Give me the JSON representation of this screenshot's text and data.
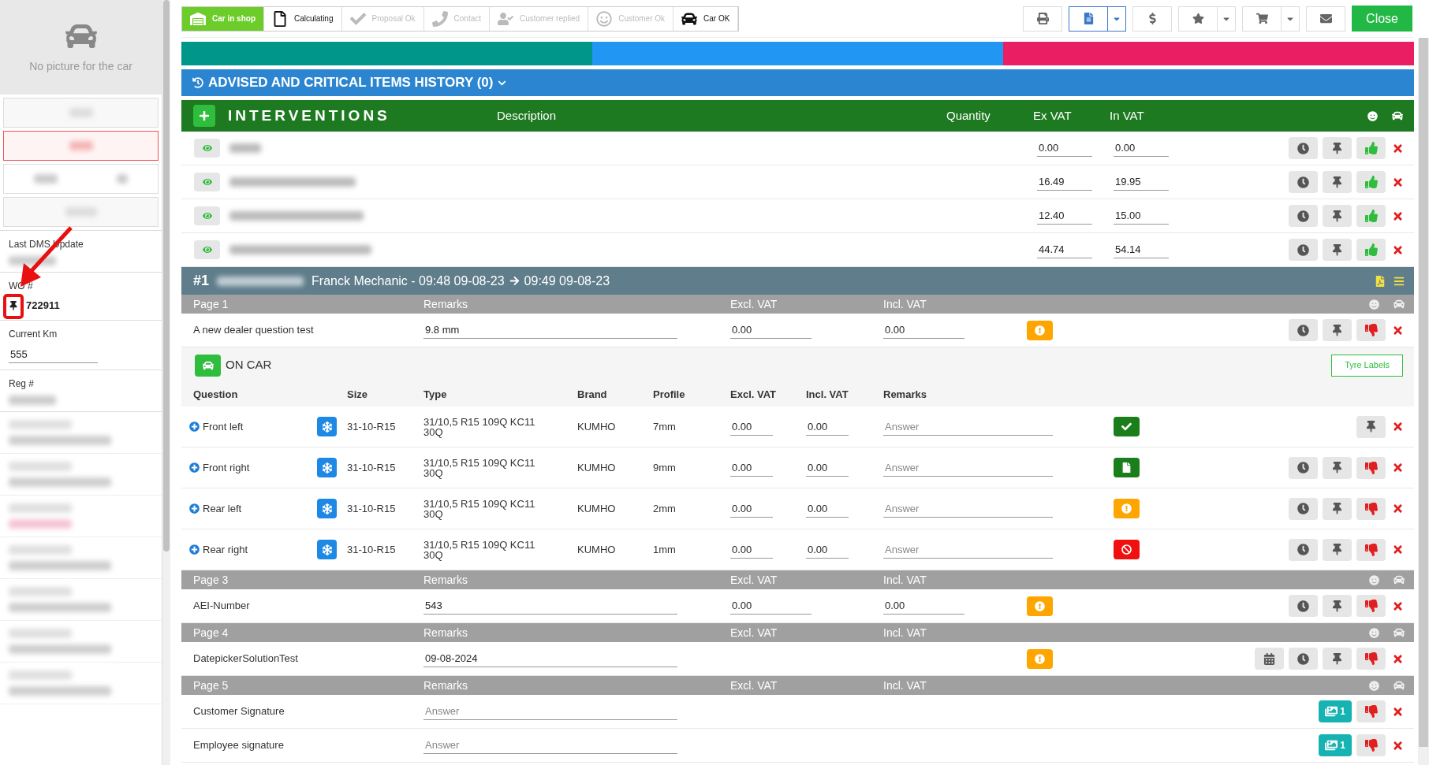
{
  "sidebar": {
    "no_picture": "No picture for the car",
    "fields": [
      {
        "label": "Last DMS Update",
        "kind": "blurred"
      },
      {
        "label": "WO #",
        "kind": "pinned",
        "value": "722911"
      },
      {
        "label": "Current Km",
        "kind": "input",
        "value": "555"
      },
      {
        "label": "Reg #",
        "kind": "blurred"
      }
    ]
  },
  "steps": [
    {
      "label": "Car in shop",
      "selected": true,
      "disabled": false
    },
    {
      "label": "Calculating",
      "selected": false,
      "disabled": false
    },
    {
      "label": "Proposal Ok",
      "selected": false,
      "disabled": true
    },
    {
      "label": "Contact",
      "selected": false,
      "disabled": true
    },
    {
      "label": "Customer replied",
      "selected": false,
      "disabled": true
    },
    {
      "label": "Customer Ok",
      "selected": false,
      "disabled": true
    },
    {
      "label": "Car OK",
      "selected": false,
      "disabled": false
    }
  ],
  "toolbar": [
    {
      "kind": "print"
    },
    {
      "kind": "document",
      "dropdown": true,
      "selected": true
    },
    {
      "kind": "dollar"
    },
    {
      "kind": "star",
      "dropdown": true,
      "selected": false
    },
    {
      "kind": "cart",
      "dropdown": true,
      "selected": false
    },
    {
      "kind": "mail"
    }
  ],
  "close_button": "Close",
  "progress_segments": [
    {
      "color": "#00968a"
    },
    {
      "color": "#2196f3"
    },
    {
      "color": "#e91e63"
    }
  ],
  "history_title": "ADVISED AND CRITICAL ITEMS HISTORY (0)",
  "interventions": {
    "title": "INTERVENTIONS",
    "columns": [
      "Description",
      "Quantity",
      "Ex VAT",
      "In VAT"
    ],
    "rows": [
      {
        "ex_vat": "0.00",
        "in_vat": "0.00",
        "approved": true
      },
      {
        "ex_vat": "16.49",
        "in_vat": "19.95",
        "approved": true
      },
      {
        "ex_vat": "12.40",
        "in_vat": "15.00",
        "approved": true
      },
      {
        "ex_vat": "44.74",
        "in_vat": "54.14",
        "approved": true
      }
    ]
  },
  "job": {
    "number": "#1",
    "mechanic": "Franck Mechanic - 09:48 09-08-23",
    "end": "09:49 09-08-23"
  },
  "pages": [
    {
      "title": "Page 1",
      "columns": [
        "Remarks",
        "Excl. VAT",
        "Incl. VAT"
      ],
      "rows": [
        {
          "question": "A new dealer question test",
          "remark": "9.8 mm",
          "excl": "0.00",
          "incl": "0.00",
          "badge": {
            "kind": "warning"
          },
          "actions": [
            {
              "kind": "clock"
            },
            {
              "kind": "pin"
            }
          ],
          "approved": false
        }
      ],
      "tyres": {
        "title": "ON CAR",
        "labels_button": "Tyre Labels",
        "columns": [
          "Question",
          "Size",
          "Type",
          "Brand",
          "Profile",
          "Excl. VAT",
          "Incl. VAT",
          "Remarks"
        ],
        "rows": [
          {
            "position": "Front left",
            "size": "31-10-R15",
            "type": "31/10,5 R15 109Q KC11 30Q",
            "brand": "KUMHO",
            "profile": "7mm",
            "excl": "0.00",
            "incl": "0.00",
            "placeholder": "Answer",
            "badge": {
              "kind": "ok"
            },
            "actions": [
              {
                "kind": "pin"
              }
            ]
          },
          {
            "position": "Front right",
            "size": "31-10-R15",
            "type": "31/10,5 R15 109Q KC11 30Q",
            "brand": "KUMHO",
            "profile": "9mm",
            "excl": "0.00",
            "incl": "0.00",
            "placeholder": "Answer",
            "badge": {
              "kind": "file"
            },
            "actions": [
              {
                "kind": "clock"
              },
              {
                "kind": "pin"
              }
            ],
            "approved": false
          },
          {
            "position": "Rear left",
            "size": "31-10-R15",
            "type": "31/10,5 R15 109Q KC11 30Q",
            "brand": "KUMHO",
            "profile": "2mm",
            "excl": "0.00",
            "incl": "0.00",
            "placeholder": "Answer",
            "badge": {
              "kind": "warning"
            },
            "actions": [
              {
                "kind": "clock"
              },
              {
                "kind": "pin"
              }
            ],
            "approved": false
          },
          {
            "position": "Rear right",
            "size": "31-10-R15",
            "type": "31/10,5 R15 109Q KC11 30Q",
            "brand": "KUMHO",
            "profile": "1mm",
            "excl": "0.00",
            "incl": "0.00",
            "placeholder": "Answer",
            "badge": {
              "kind": "forbidden"
            },
            "actions": [
              {
                "kind": "clock"
              },
              {
                "kind": "pin"
              }
            ],
            "approved": false
          }
        ]
      }
    },
    {
      "title": "Page 3",
      "columns": [
        "Remarks",
        "Excl. VAT",
        "Incl. VAT"
      ],
      "rows": [
        {
          "question": "AEI-Number",
          "remark": "543",
          "excl": "0.00",
          "incl": "0.00",
          "badge": {
            "kind": "warning"
          },
          "actions": [
            {
              "kind": "clock"
            },
            {
              "kind": "pin"
            }
          ],
          "approved": false
        }
      ]
    },
    {
      "title": "Page 4",
      "columns": [
        "Remarks",
        "Excl. VAT",
        "Incl. VAT"
      ],
      "rows": [
        {
          "question": "DatepickerSolutionTest",
          "remark": "09-08-2024",
          "badge": {
            "kind": "warning"
          },
          "actions": [
            {
              "kind": "calendar"
            },
            {
              "kind": "clock"
            },
            {
              "kind": "pin"
            }
          ],
          "approved": false
        }
      ]
    },
    {
      "title": "Page 5",
      "columns": [
        "Remarks",
        "Excl. VAT",
        "Incl. VAT"
      ],
      "rows": [
        {
          "question": "Customer Signature",
          "placeholder": "Answer",
          "images": "1",
          "approved": false
        },
        {
          "question": "Employee signature",
          "placeholder": "Answer",
          "images": "1",
          "approved": false
        }
      ]
    }
  ]
}
